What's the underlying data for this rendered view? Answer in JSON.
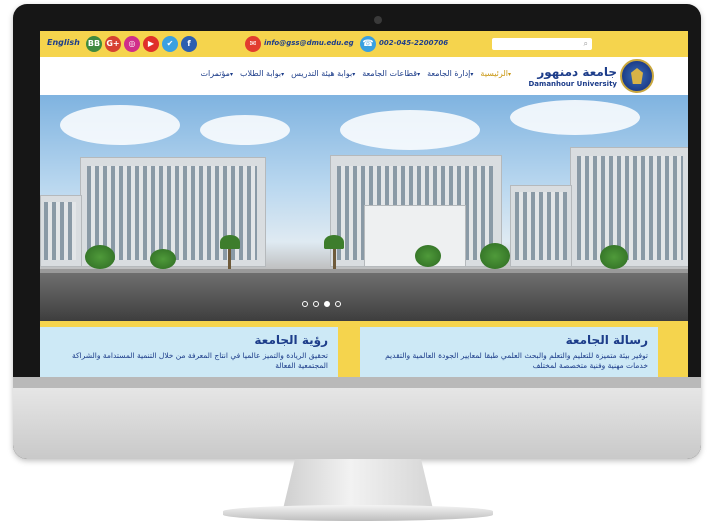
{
  "topbar": {
    "language_link": "English",
    "social_icons": [
      {
        "name": "bb-icon",
        "label": "BB",
        "color": "#3f8a3f"
      },
      {
        "name": "google-plus-icon",
        "label": "G+",
        "color": "#d64131"
      },
      {
        "name": "instagram-icon",
        "label": "◎",
        "color": "#d02d8a"
      },
      {
        "name": "youtube-icon",
        "label": "▶",
        "color": "#e0302a"
      },
      {
        "name": "twitter-icon",
        "label": "✔",
        "color": "#3aa0e0"
      },
      {
        "name": "facebook-icon",
        "label": "f",
        "color": "#2d5fb0"
      }
    ],
    "email_icon": "✉",
    "email": "info@gss@dmu.edu.eg",
    "phone_icon": "☎",
    "phone": "002-045-2200706",
    "search_placeholder": "",
    "search_icon": "search-icon"
  },
  "header": {
    "brand_ar": "جامعة دمنهور",
    "brand_en": "Damanhour University",
    "nav": [
      {
        "label": "الرئيسية",
        "active": true
      },
      {
        "label": "إدارة الجامعة",
        "active": false
      },
      {
        "label": "قطاعات الجامعة",
        "active": false
      },
      {
        "label": "بوابة هيئة التدريس",
        "active": false
      },
      {
        "label": "بوابة الطلاب",
        "active": false
      },
      {
        "label": "مؤتمرات",
        "active": false
      }
    ]
  },
  "slider": {
    "total_slides": 4,
    "active_slide": 3
  },
  "cards": {
    "vision": {
      "title": "رؤية الجامعة",
      "text": "تحقيق الريادة والتميز عالميا في انتاج المعرفة من خلال التنمية المستدامة والشراكة المجتمعية الفعالة"
    },
    "mission": {
      "title": "رسالة الجامعة",
      "text": "توفير بيئة متميزة للتعليم والتعلم والبحث العلمي طبقا لمعايير الجودة العالمية والتقديم خدمات مهنية وفنية متخصصة لمختلف"
    }
  },
  "colors": {
    "accent_yellow": "#f5d44d",
    "brand_blue": "#1d3d8a",
    "card_blue": "#cde9f6"
  }
}
